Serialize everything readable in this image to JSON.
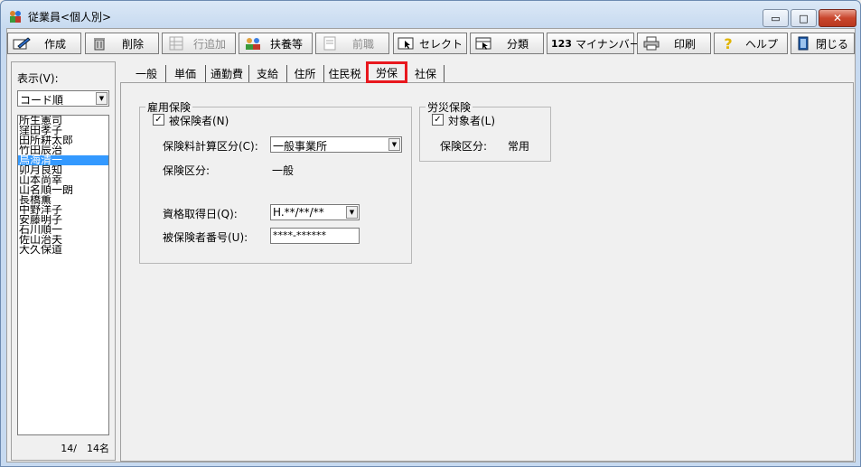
{
  "window": {
    "title": "従業員<個人別>",
    "minimize_glyph": "▭",
    "maximize_glyph": "□",
    "close_glyph": "✕"
  },
  "toolbar": {
    "create": "作成",
    "delete": "削除",
    "add_row": "行追加",
    "dependents": "扶養等",
    "previous_job": "前職",
    "select": "セレクト",
    "classify": "分類",
    "mynumber": "マイナンバー",
    "mynumber_icon_text": "123",
    "print": "印刷",
    "help": "ヘルプ",
    "close": "閉じる"
  },
  "left_pane": {
    "display_label": "表示(V):",
    "sort_value": "コード順",
    "employees": [
      "所生憲司",
      "窪田孝子",
      "田所耕太郎",
      "竹田辰治",
      "鳥海清一",
      "卯月良知",
      "山本尚幸",
      "山名順一朗",
      "長橋薫",
      "中野洋子",
      "安藤明子",
      "石川順一",
      "佐山治夫",
      "大久保道"
    ],
    "selected_index": 4,
    "count_text": "14/　14名"
  },
  "tabs": [
    "一般",
    "単価",
    "通勤費",
    "支給",
    "住所",
    "住民税",
    "労保",
    "社保"
  ],
  "active_tab": "労保",
  "employment_insurance": {
    "legend": "雇用保険",
    "insured_label": "被保険者(N)",
    "insured_checked": true,
    "calc_category_label": "保険料計算区分(C):",
    "calc_category_value": "一般事業所",
    "category_label": "保険区分:",
    "category_value": "一般",
    "acquired_date_label": "資格取得日(Q):",
    "acquired_date_value": "H.**/**/**",
    "insured_number_label": "被保険者番号(U):",
    "insured_number_value": "****-******"
  },
  "workers_comp": {
    "legend": "労災保険",
    "target_label": "対象者(L)",
    "target_checked": true,
    "category_label": "保険区分:",
    "category_value": "常用"
  },
  "colors": {
    "selection": "#3399ff",
    "active_tab_outline": "#e8181e"
  }
}
